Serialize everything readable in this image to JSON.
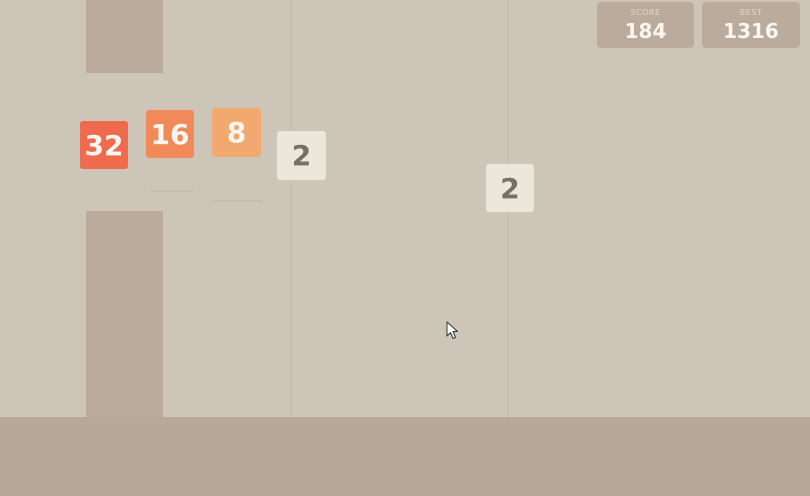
{
  "scoreboard": {
    "score_label": "SCORE",
    "score_value": "184",
    "best_label": "BEST",
    "best_value": "1316"
  },
  "tiles": {
    "t32": "32",
    "t16": "16",
    "t8": "8",
    "t2a": "2",
    "t2b": "2"
  },
  "colors": {
    "background": "#cdc5b8",
    "floor": "#b8a898",
    "pipe": "#baab9d",
    "tile_32": "#f06a4e",
    "tile_16": "#f08a59",
    "tile_8": "#f1a96f",
    "tile_2": "#ede6db",
    "dark_text": "#776e65",
    "light_text": "#f9f6f2"
  }
}
